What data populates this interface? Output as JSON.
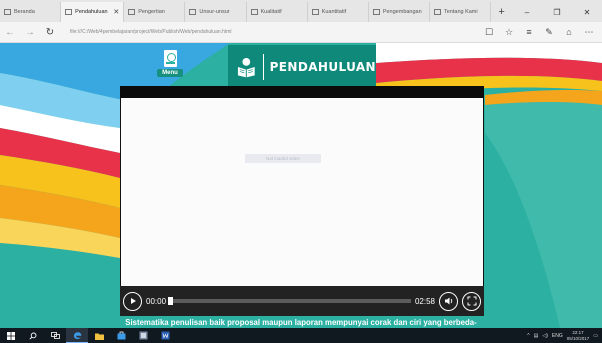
{
  "browser": {
    "tabs": [
      {
        "title": "Beranda",
        "active": false
      },
      {
        "title": "Pendahuluan",
        "active": true
      },
      {
        "title": "Pengertian",
        "active": false
      },
      {
        "title": "Unsur-unsur",
        "active": false
      },
      {
        "title": "Kualitatif",
        "active": false
      },
      {
        "title": "Kuantitatif",
        "active": false
      },
      {
        "title": "Pengembangan",
        "active": false
      },
      {
        "title": "Tentang Kami",
        "active": false
      }
    ],
    "close_glyph": "✕",
    "new_tab_glyph": "+",
    "window_controls": {
      "minimize": "–",
      "maximize": "❐",
      "close": "✕"
    },
    "address": "file:///C:/Web/4pembelajaran/project/Web/Publish/Web/pendahuluan.html",
    "nav": {
      "back": "←",
      "forward": "→",
      "refresh": "↻"
    },
    "toolbar_icons": {
      "reading_view": "☐",
      "favorite": "☆",
      "hub": "≡",
      "note": "✎",
      "share": "⌂",
      "more": "⋯"
    }
  },
  "page": {
    "menu_label": "Menu",
    "title": "PENDAHULUAN",
    "video": {
      "placeholder": "Not loaded video",
      "current_time": "00:00",
      "duration": "02:58",
      "progress": 0
    },
    "subtitle": "Sistematika penulisan baik proposal maupun laporan mempunyai corak dan ciri yang berbeda-",
    "colors": {
      "teal": "#2bb0a2",
      "banner": "#0f8a7a",
      "red": "#e8324a",
      "yellow": "#f7c21c",
      "blue": "#3aa8e0"
    }
  },
  "taskbar": {
    "icons": [
      "windows-icon",
      "search-icon",
      "task-view-icon",
      "edge-icon",
      "explorer-icon",
      "store-icon",
      "app-icon",
      "word-icon"
    ],
    "tray": {
      "language": "ENG",
      "time": "22:17",
      "date": "05/10/2017"
    }
  }
}
